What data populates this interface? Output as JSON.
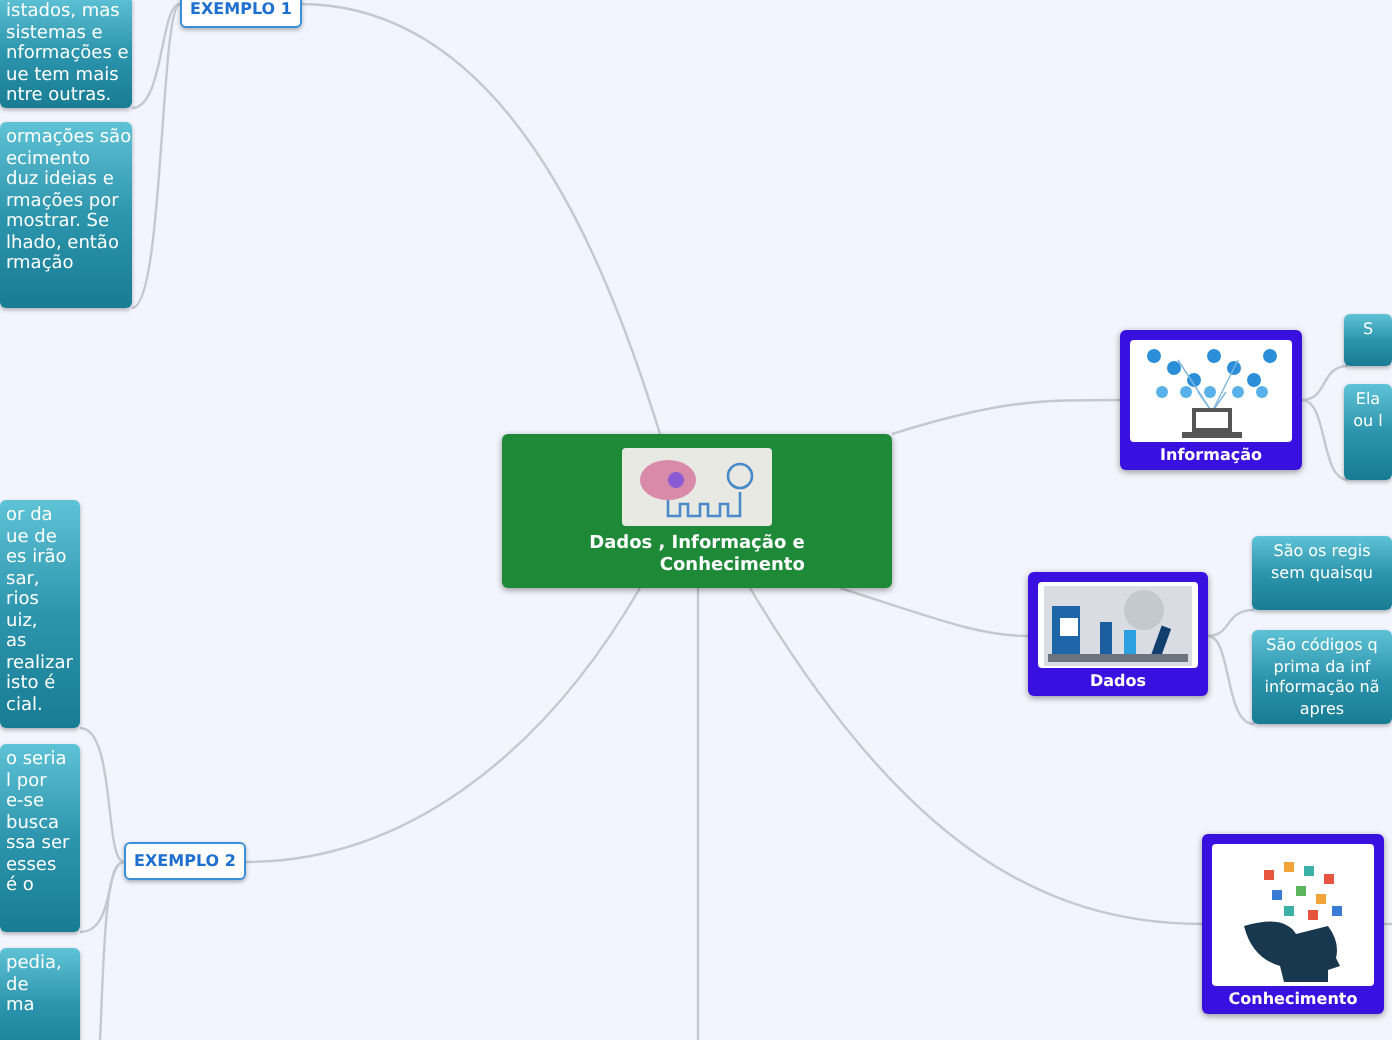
{
  "central": {
    "title_lines": [
      "Dados , Informação e",
      "Conhecimento"
    ]
  },
  "examples": [
    {
      "label": "EXEMPLO 1",
      "notes": [
        {
          "lines": [
            "istados, mas",
            "sistemas e",
            "nformações e",
            "ue tem mais",
            "ntre outras."
          ]
        },
        {
          "lines": [
            "ormações são",
            "ecimento",
            "duz ideias e",
            "rmações por",
            "mostrar. Se",
            "lhado, então",
            "rmação"
          ]
        }
      ]
    },
    {
      "label": "EXEMPLO 2",
      "notes": [
        {
          "lines": [
            "or da",
            "ue de",
            "es irão",
            "sar,",
            "rios",
            "uiz,",
            "as",
            "realizar",
            "isto é",
            "cial."
          ]
        },
        {
          "lines": [
            "o seria",
            "l por",
            "e-se",
            "busca",
            "ssa ser",
            "esses",
            "é o"
          ]
        },
        {
          "lines": [
            "pedia,",
            "de",
            "ma"
          ]
        }
      ]
    }
  ],
  "topics": [
    {
      "label": "Informação",
      "kind": "network",
      "notes": [
        {
          "lines": [
            "S"
          ]
        },
        {
          "lines": [
            "Ela",
            "ou l"
          ]
        }
      ]
    },
    {
      "label": "Dados",
      "kind": "chart",
      "notes": [
        {
          "lines": [
            "São os regis",
            "sem quaisqu"
          ]
        },
        {
          "lines": [
            "São códigos q",
            "prima da inf",
            "informação nã",
            "apres"
          ]
        }
      ]
    },
    {
      "label": "Conhecimento",
      "kind": "head"
    }
  ]
}
